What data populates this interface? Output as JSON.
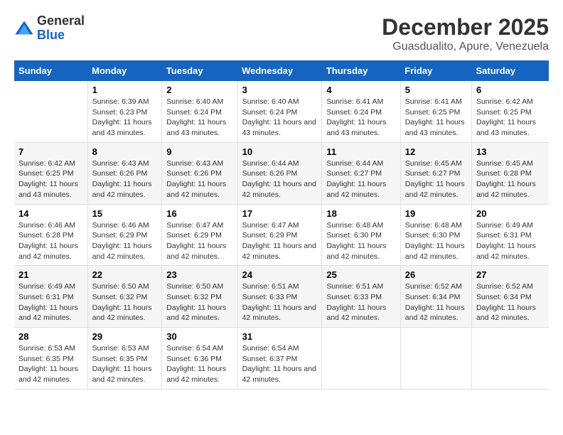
{
  "logo": {
    "general": "General",
    "blue": "Blue"
  },
  "title": "December 2025",
  "subtitle": "Guasdualito, Apure, Venezuela",
  "weekdays": [
    "Sunday",
    "Monday",
    "Tuesday",
    "Wednesday",
    "Thursday",
    "Friday",
    "Saturday"
  ],
  "weeks": [
    [
      {
        "day": "",
        "sunrise": "",
        "sunset": "",
        "daylight": ""
      },
      {
        "day": "1",
        "sunrise": "Sunrise: 6:39 AM",
        "sunset": "Sunset: 6:23 PM",
        "daylight": "Daylight: 11 hours and 43 minutes."
      },
      {
        "day": "2",
        "sunrise": "Sunrise: 6:40 AM",
        "sunset": "Sunset: 6:24 PM",
        "daylight": "Daylight: 11 hours and 43 minutes."
      },
      {
        "day": "3",
        "sunrise": "Sunrise: 6:40 AM",
        "sunset": "Sunset: 6:24 PM",
        "daylight": "Daylight: 11 hours and 43 minutes."
      },
      {
        "day": "4",
        "sunrise": "Sunrise: 6:41 AM",
        "sunset": "Sunset: 6:24 PM",
        "daylight": "Daylight: 11 hours and 43 minutes."
      },
      {
        "day": "5",
        "sunrise": "Sunrise: 6:41 AM",
        "sunset": "Sunset: 6:25 PM",
        "daylight": "Daylight: 11 hours and 43 minutes."
      },
      {
        "day": "6",
        "sunrise": "Sunrise: 6:42 AM",
        "sunset": "Sunset: 6:25 PM",
        "daylight": "Daylight: 11 hours and 43 minutes."
      }
    ],
    [
      {
        "day": "7",
        "sunrise": "Sunrise: 6:42 AM",
        "sunset": "Sunset: 6:25 PM",
        "daylight": "Daylight: 11 hours and 43 minutes."
      },
      {
        "day": "8",
        "sunrise": "Sunrise: 6:43 AM",
        "sunset": "Sunset: 6:26 PM",
        "daylight": "Daylight: 11 hours and 42 minutes."
      },
      {
        "day": "9",
        "sunrise": "Sunrise: 6:43 AM",
        "sunset": "Sunset: 6:26 PM",
        "daylight": "Daylight: 11 hours and 42 minutes."
      },
      {
        "day": "10",
        "sunrise": "Sunrise: 6:44 AM",
        "sunset": "Sunset: 6:26 PM",
        "daylight": "Daylight: 11 hours and 42 minutes."
      },
      {
        "day": "11",
        "sunrise": "Sunrise: 6:44 AM",
        "sunset": "Sunset: 6:27 PM",
        "daylight": "Daylight: 11 hours and 42 minutes."
      },
      {
        "day": "12",
        "sunrise": "Sunrise: 6:45 AM",
        "sunset": "Sunset: 6:27 PM",
        "daylight": "Daylight: 11 hours and 42 minutes."
      },
      {
        "day": "13",
        "sunrise": "Sunrise: 6:45 AM",
        "sunset": "Sunset: 6:28 PM",
        "daylight": "Daylight: 11 hours and 42 minutes."
      }
    ],
    [
      {
        "day": "14",
        "sunrise": "Sunrise: 6:46 AM",
        "sunset": "Sunset: 6:28 PM",
        "daylight": "Daylight: 11 hours and 42 minutes."
      },
      {
        "day": "15",
        "sunrise": "Sunrise: 6:46 AM",
        "sunset": "Sunset: 6:29 PM",
        "daylight": "Daylight: 11 hours and 42 minutes."
      },
      {
        "day": "16",
        "sunrise": "Sunrise: 6:47 AM",
        "sunset": "Sunset: 6:29 PM",
        "daylight": "Daylight: 11 hours and 42 minutes."
      },
      {
        "day": "17",
        "sunrise": "Sunrise: 6:47 AM",
        "sunset": "Sunset: 6:29 PM",
        "daylight": "Daylight: 11 hours and 42 minutes."
      },
      {
        "day": "18",
        "sunrise": "Sunrise: 6:48 AM",
        "sunset": "Sunset: 6:30 PM",
        "daylight": "Daylight: 11 hours and 42 minutes."
      },
      {
        "day": "19",
        "sunrise": "Sunrise: 6:48 AM",
        "sunset": "Sunset: 6:30 PM",
        "daylight": "Daylight: 11 hours and 42 minutes."
      },
      {
        "day": "20",
        "sunrise": "Sunrise: 6:49 AM",
        "sunset": "Sunset: 6:31 PM",
        "daylight": "Daylight: 11 hours and 42 minutes."
      }
    ],
    [
      {
        "day": "21",
        "sunrise": "Sunrise: 6:49 AM",
        "sunset": "Sunset: 6:31 PM",
        "daylight": "Daylight: 11 hours and 42 minutes."
      },
      {
        "day": "22",
        "sunrise": "Sunrise: 6:50 AM",
        "sunset": "Sunset: 6:32 PM",
        "daylight": "Daylight: 11 hours and 42 minutes."
      },
      {
        "day": "23",
        "sunrise": "Sunrise: 6:50 AM",
        "sunset": "Sunset: 6:32 PM",
        "daylight": "Daylight: 11 hours and 42 minutes."
      },
      {
        "day": "24",
        "sunrise": "Sunrise: 6:51 AM",
        "sunset": "Sunset: 6:33 PM",
        "daylight": "Daylight: 11 hours and 42 minutes."
      },
      {
        "day": "25",
        "sunrise": "Sunrise: 6:51 AM",
        "sunset": "Sunset: 6:33 PM",
        "daylight": "Daylight: 11 hours and 42 minutes."
      },
      {
        "day": "26",
        "sunrise": "Sunrise: 6:52 AM",
        "sunset": "Sunset: 6:34 PM",
        "daylight": "Daylight: 11 hours and 42 minutes."
      },
      {
        "day": "27",
        "sunrise": "Sunrise: 6:52 AM",
        "sunset": "Sunset: 6:34 PM",
        "daylight": "Daylight: 11 hours and 42 minutes."
      }
    ],
    [
      {
        "day": "28",
        "sunrise": "Sunrise: 6:53 AM",
        "sunset": "Sunset: 6:35 PM",
        "daylight": "Daylight: 11 hours and 42 minutes."
      },
      {
        "day": "29",
        "sunrise": "Sunrise: 6:53 AM",
        "sunset": "Sunset: 6:35 PM",
        "daylight": "Daylight: 11 hours and 42 minutes."
      },
      {
        "day": "30",
        "sunrise": "Sunrise: 6:54 AM",
        "sunset": "Sunset: 6:36 PM",
        "daylight": "Daylight: 11 hours and 42 minutes."
      },
      {
        "day": "31",
        "sunrise": "Sunrise: 6:54 AM",
        "sunset": "Sunset: 6:37 PM",
        "daylight": "Daylight: 11 hours and 42 minutes."
      },
      {
        "day": "",
        "sunrise": "",
        "sunset": "",
        "daylight": ""
      },
      {
        "day": "",
        "sunrise": "",
        "sunset": "",
        "daylight": ""
      },
      {
        "day": "",
        "sunrise": "",
        "sunset": "",
        "daylight": ""
      }
    ]
  ]
}
